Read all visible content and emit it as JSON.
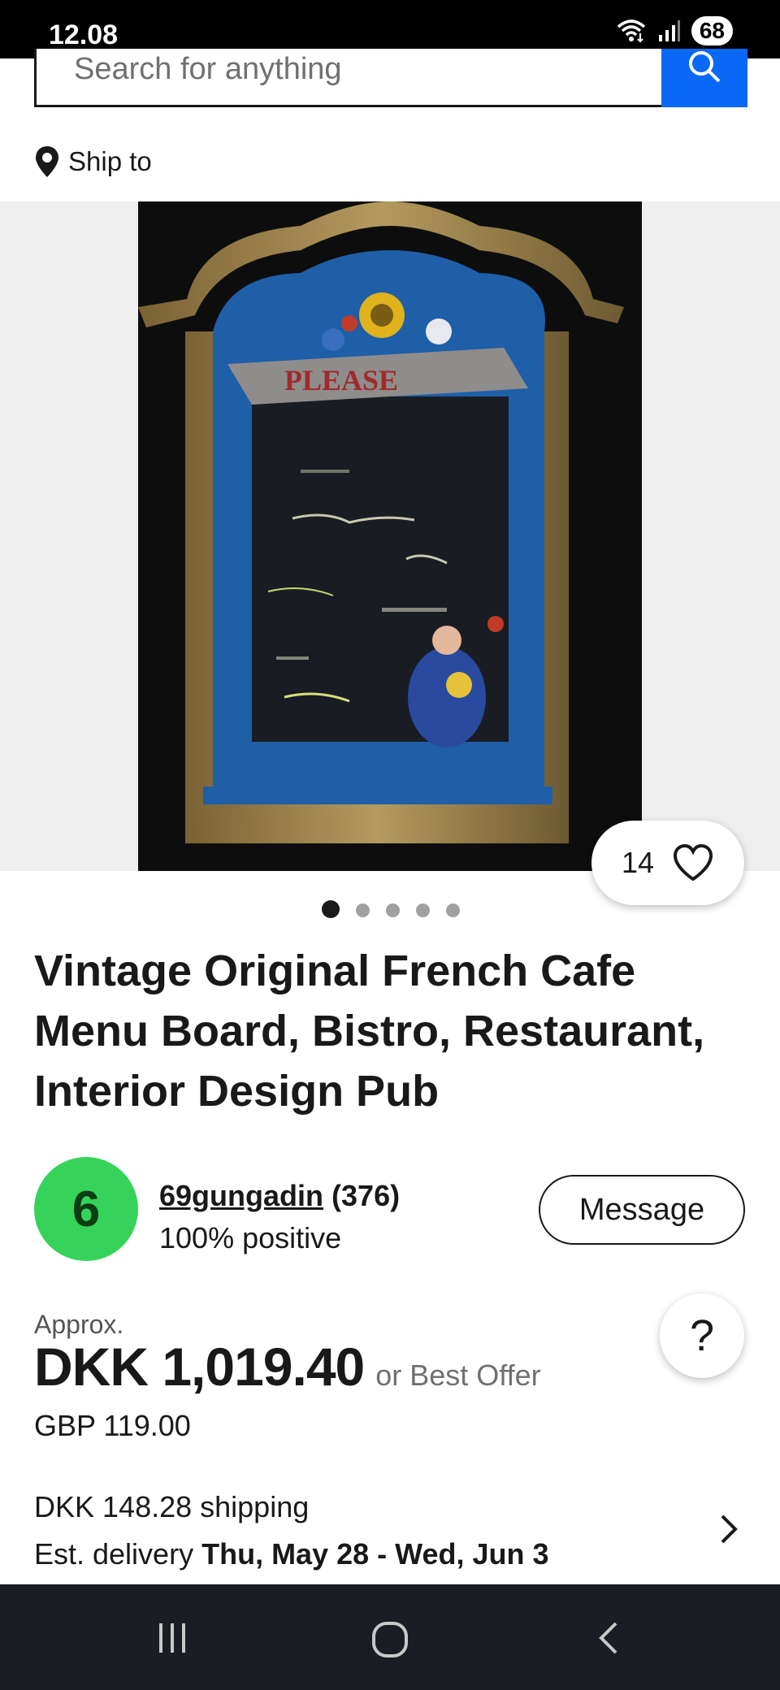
{
  "status_bar": {
    "time": "12.08",
    "battery": "68",
    "icons": [
      "wifi-icon",
      "signal-icon",
      "battery-icon"
    ]
  },
  "search": {
    "placeholder": "Search for anything",
    "button_icon": "search-icon"
  },
  "ship_to": {
    "label": "Ship to",
    "icon": "location-pin-icon"
  },
  "gallery": {
    "image_alt_text_on_board": "PLEASE",
    "dots_total": 5,
    "active_dot": 1
  },
  "watch": {
    "count": "14",
    "icon": "heart-icon"
  },
  "listing": {
    "title": "Vintage Original French Cafe Menu Board, Bistro, Restaurant, Interior Design Pub"
  },
  "seller": {
    "avatar_letter": "6",
    "name": "69gungadin",
    "feedback_count": "(376)",
    "positive": "100% positive",
    "message_label": "Message"
  },
  "price": {
    "approx_label": "Approx.",
    "amount": "DKK 1,019.40",
    "best_offer": "or Best Offer",
    "original": "GBP 119.00"
  },
  "help": {
    "label": "?"
  },
  "shipping": {
    "cost": "DKK 148.28 shipping",
    "delivery_label": "Est. delivery",
    "delivery_dates": "Thu, May 28 - Wed, Jun 3"
  },
  "colors": {
    "search_button": "#0968f6",
    "avatar": "#36d35a",
    "nav_bar": "#1a1d23"
  }
}
